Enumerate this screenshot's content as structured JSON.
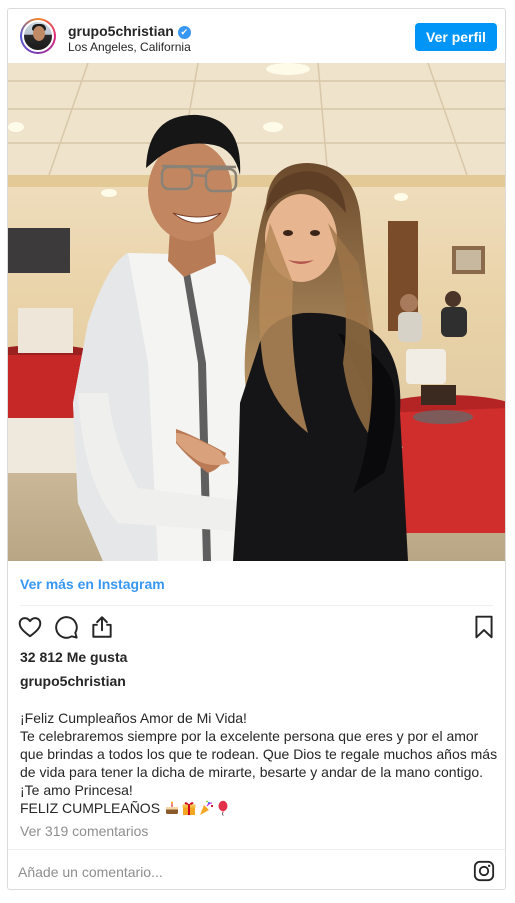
{
  "header": {
    "username": "grupo5christian",
    "location": "Los Angeles, California",
    "profile_button": "Ver perfil",
    "avatar_icon": "user-avatar-icon",
    "verified_icon": "verified-badge-icon"
  },
  "photo": {
    "description_icon": "couple-photo"
  },
  "links": {
    "view_more": "Ver más en Instagram"
  },
  "actions": {
    "like_icon": "heart-icon",
    "comment_icon": "comment-icon",
    "share_icon": "share-icon",
    "save_icon": "bookmark-icon"
  },
  "stats": {
    "likes": "32 812 Me gusta"
  },
  "caption": {
    "username": "grupo5christian",
    "lines": [
      "¡Feliz Cumpleaños Amor de Mi Vida!",
      "Te celebraremos siempre por la excelente persona que eres y por el amor",
      "que brindas a todos los que te rodean. Que Dios te regale muchos años más",
      "de vida para tener la dicha de mirarte, besarte y andar de la mano contigo.",
      "¡Te amo Princesa!",
      "FELIZ CUMPLEAÑOS"
    ],
    "emojis": [
      "cake-icon",
      "gift-icon",
      "party-popper-icon",
      "balloon-icon"
    ]
  },
  "comments": {
    "view_all": "Ver 319 comentarios"
  },
  "footer": {
    "placeholder": "Añade un comentario...",
    "instagram_icon": "instagram-logo-icon"
  },
  "colors": {
    "accent": "#0095f6",
    "link": "#3897f0",
    "muted": "#8e8e8e",
    "border": "#dbdbdb"
  }
}
